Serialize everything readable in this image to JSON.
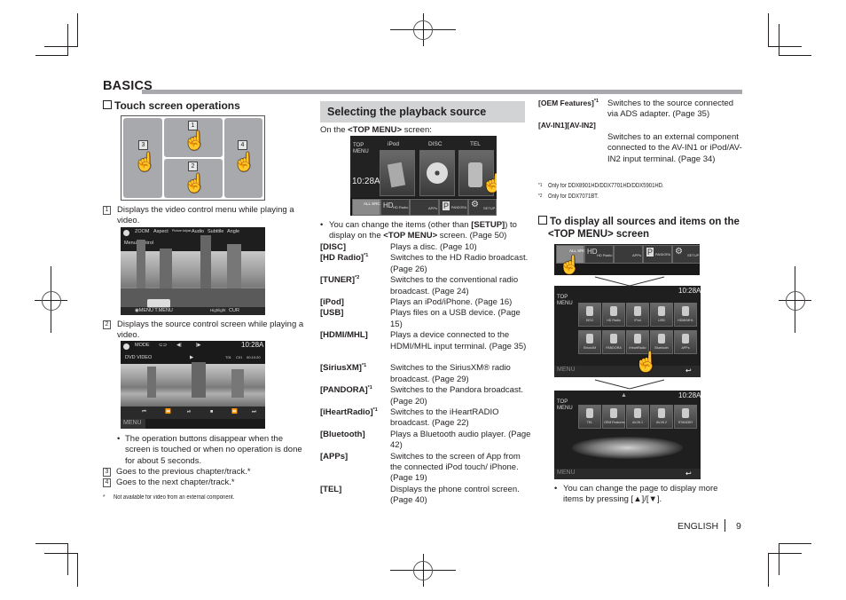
{
  "page": {
    "section_header": "BASICS",
    "language": "ENGLISH",
    "page_number": "9"
  },
  "touch_ops": {
    "title": "Touch screen operations",
    "zones": [
      "1",
      "2",
      "3",
      "4"
    ],
    "items": [
      {
        "num": "1",
        "text": "Displays the video control menu while playing a video."
      },
      {
        "num": "2",
        "text": "Displays the source control screen while playing a video."
      },
      {
        "num": "3",
        "text": "Goes to the previous chapter/track.*"
      },
      {
        "num": "4",
        "text": "Goes to the next chapter/track.*"
      }
    ],
    "bullet": "The operation buttons disappear when the screen is touched or when no operation is done for about 5 seconds.",
    "footnote_mark": "*",
    "footnote": "Not available for video from an external component.",
    "video_menu": {
      "buttons": [
        "ZOOM",
        "Aspect",
        "Picture Adjust",
        "Audio",
        "Subtitle",
        "Angle"
      ],
      "label": "Menu Control",
      "bottom_left": "◉MENU T.MENU",
      "bottom_right_label": "Highlight",
      "bottom_right": "CUR"
    },
    "source_control": {
      "mode": "MODE",
      "time": "10:28A",
      "source": "DVD VIDEO",
      "info": [
        "T01",
        "C01",
        "00:10:20"
      ],
      "controls": [
        "⏮",
        "⏪",
        "⏯",
        "■",
        "⏩",
        "⏭"
      ],
      "menu": "MENU"
    }
  },
  "playback": {
    "title": "Selecting the playback source",
    "intro_prefix": "On the ",
    "intro_bold": "<TOP MENU>",
    "intro_suffix": " screen:",
    "top_menu_screen": {
      "label": "TOP MENU",
      "time": "10:28A",
      "tiles": [
        "iPod",
        "DISC",
        "TEL"
      ],
      "bar": [
        "ALL SRC",
        "HD Radio",
        "APPs",
        "PANDORA",
        "SETUP"
      ]
    },
    "bullet_prefix": "You can change the items (other than ",
    "bullet_bold1": "[SETUP]",
    "bullet_mid": ") to display on the ",
    "bullet_bold2": "<TOP MENU>",
    "bullet_suffix": " screen. (Page 50)",
    "sources": [
      {
        "term": "[DISC]",
        "sup": "",
        "desc": "Plays a disc. (Page 10)"
      },
      {
        "term": "[HD Radio]",
        "sup": "*1",
        "desc": "Switches to the HD Radio broadcast. (Page 26)"
      },
      {
        "term": "[TUNER]",
        "sup": "*2",
        "desc": "Switches to the conventional radio broadcast. (Page 24)"
      },
      {
        "term": "[iPod]",
        "sup": "",
        "desc": "Plays an iPod/iPhone. (Page 16)"
      },
      {
        "term": "[USB]",
        "sup": "",
        "desc": "Plays files on a USB device. (Page 15)"
      },
      {
        "term": "[HDMI/MHL]",
        "sup": "",
        "desc": "Plays a device connected to the HDMI/MHL input terminal. (Page 35)"
      },
      {
        "term": "[SiriusXM]",
        "sup": "*1",
        "desc": "Switches to the SiriusXM® radio broadcast. (Page 29)"
      },
      {
        "term": "[PANDORA]",
        "sup": "*1",
        "desc": "Switches to the Pandora broadcast. (Page 20)"
      },
      {
        "term": "[iHeartRadio]",
        "sup": "*1",
        "desc": "Switches to the iHeartRADIO broadcast. (Page 22)"
      },
      {
        "term": "[Bluetooth]",
        "sup": "",
        "desc": "Plays a Bluetooth audio player. (Page 42)"
      },
      {
        "term": "[APPs]",
        "sup": "",
        "desc": "Switches to the screen of App from the connected iPod touch/ iPhone. (Page 19)"
      },
      {
        "term": "[TEL]",
        "sup": "",
        "desc": "Displays the phone control screen. (Page 40)"
      }
    ]
  },
  "right_col": {
    "oem_term": "[OEM Features]",
    "oem_sup": "*1",
    "oem_desc": "Switches to the source connected via ADS adapter. (Page 35)",
    "avin_term": "[AV-IN1][AV-IN2]",
    "avin_desc": "Switches to an external component connected to the AV-IN1 or iPod/AV-IN2 input terminal. (Page 34)",
    "footnotes": [
      {
        "mark": "*1",
        "text": "Only for DDX8901HD/DDX7701HD/DDX5901HD."
      },
      {
        "mark": "*2",
        "text": "Only for DDX7071BT."
      }
    ],
    "subtitle_line1": "To display all sources and items on the",
    "subtitle_line2": "<TOP MENU> screen",
    "bar": [
      "ALL SRC",
      "HD Radio",
      "APPs",
      "PANDORA",
      "SETUP"
    ],
    "screen2": {
      "label": "TOP MENU",
      "time": "10:28A",
      "row1": [
        "DISC",
        "HD Radio",
        "iPod",
        "USB",
        "HDMI/MHL"
      ],
      "row2": [
        "SiriusXM",
        "PANDORA",
        "iHeartRadio",
        "Bluetooth",
        "APPs"
      ],
      "menu": "MENU"
    },
    "screen3": {
      "label": "TOP MENU",
      "time": "10:28A",
      "row1": [
        "TEL",
        "OEM Features",
        "AV-IN 1",
        "AV-IN 2",
        "STANDBY"
      ],
      "menu": "MENU"
    },
    "bullet": "You can change the page to display more items by pressing [▲]/[▼]."
  }
}
